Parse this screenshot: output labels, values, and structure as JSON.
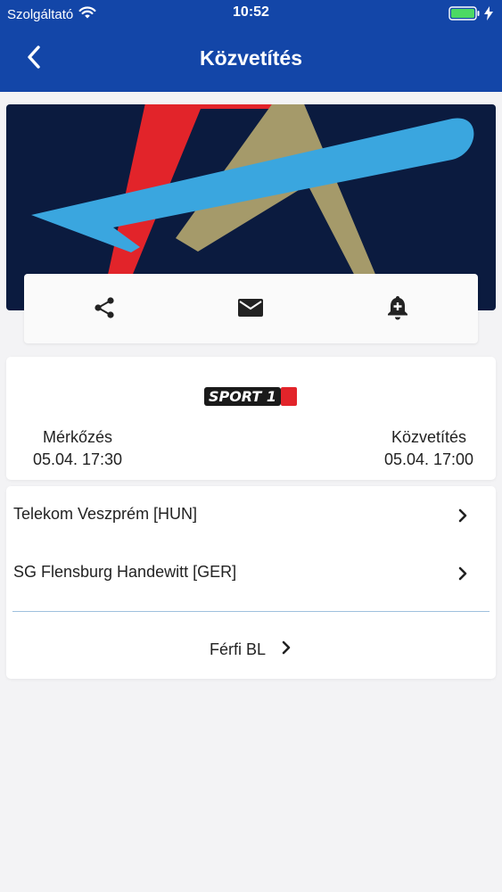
{
  "status_bar": {
    "carrier": "Szolgáltató",
    "time": "10:52"
  },
  "nav": {
    "title": "Közvetítés",
    "back_icon": "chevron-left-icon"
  },
  "actions": [
    {
      "icon": "share-icon"
    },
    {
      "icon": "mail-icon"
    },
    {
      "icon": "bell-plus-icon"
    }
  ],
  "broadcast": {
    "channel_logo_text": "SPORT 1",
    "match_label": "Mérkőzés",
    "match_time": "05.04. 17:30",
    "broadcast_label": "Közvetítés",
    "broadcast_time": "05.04. 17:00"
  },
  "teams": [
    {
      "name": "Telekom Veszprém [HUN]"
    },
    {
      "name": "SG Flensburg Handewitt [GER]"
    }
  ],
  "league": {
    "label": "Férfi BL"
  },
  "colors": {
    "header_bg": "#1346a8",
    "page_bg": "#f3f3f5",
    "banner_bg": "#0b1b3f",
    "logo_red": "#e2242a",
    "logo_blue": "#3aa6df",
    "logo_gold": "#a59a6a",
    "battery": "#4cd964",
    "divider": "#9fc1de"
  }
}
